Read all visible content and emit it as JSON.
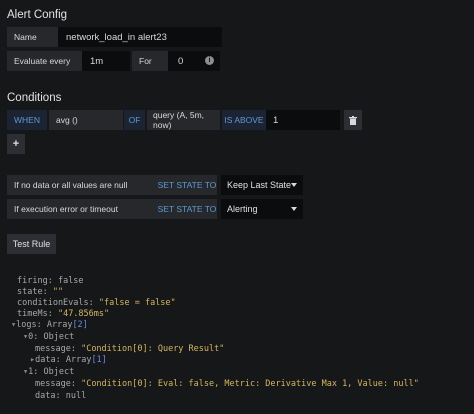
{
  "alert_config": {
    "title": "Alert Config",
    "name_label": "Name",
    "name_value": "network_load_in alert23",
    "evaluate_every_label": "Evaluate every",
    "evaluate_every_value": "1m",
    "for_label": "For",
    "for_value": "0"
  },
  "conditions": {
    "title": "Conditions",
    "when": "WHEN",
    "func": "avg ()",
    "of": "OF",
    "query": "query (A, 5m, now)",
    "evaluator": "IS ABOVE",
    "threshold": "1",
    "add_label": "+"
  },
  "no_data": {
    "label": "If no data or all values are null",
    "set_state": "SET STATE TO",
    "value": "Keep Last State"
  },
  "exec_error": {
    "label": "If execution error or timeout",
    "set_state": "SET STATE TO",
    "value": "Alerting"
  },
  "test_rule_label": "Test Rule",
  "result": {
    "firing_key": "firing:",
    "firing_val": "false",
    "state_key": "state:",
    "state_val": "\"\"",
    "cond_key": "conditionEvals:",
    "cond_val": "\"false = false\"",
    "time_key": "timeMs:",
    "time_val": "\"47.856ms\"",
    "logs_key": "logs:",
    "logs_type": "Array",
    "logs_count": "[2]",
    "l0_key": "0:",
    "l0_type": "Object",
    "l0_msg_key": "message:",
    "l0_msg_val": "\"Condition[0]: Query Result\"",
    "l0_data_key": "data:",
    "l0_data_type": "Array",
    "l0_data_count": "[1]",
    "l1_key": "1:",
    "l1_type": "Object",
    "l1_msg_key": "message:",
    "l1_msg_val": "\"Condition[0]: Eval: false, Metric: Derivative Max 1, Value: null\"",
    "l1_data_key": "data:",
    "l1_data_val": "null"
  }
}
